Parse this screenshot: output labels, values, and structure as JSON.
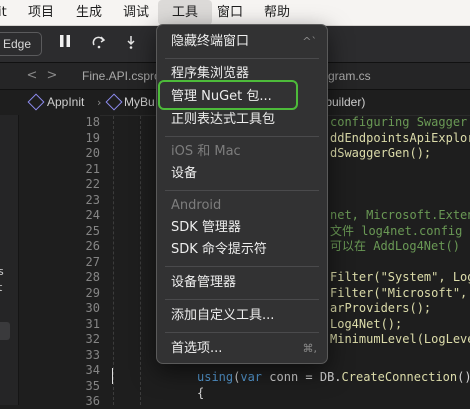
{
  "menubar": {
    "items": [
      {
        "label": "it"
      },
      {
        "label": "项目"
      },
      {
        "label": "生成"
      },
      {
        "label": "调试"
      },
      {
        "label": "工具"
      },
      {
        "label": "窗口"
      },
      {
        "label": "帮助"
      }
    ]
  },
  "toolbar": {
    "edge_label": "Edge",
    "icons": [
      "pause-icon",
      "step-over-icon",
      "step-into-icon"
    ]
  },
  "tabs": {
    "back_label": "<",
    "forward_label": ">",
    "items": [
      {
        "label": "Fine.API.cspro"
      },
      {
        "label": "gram.cs"
      }
    ]
  },
  "breadcrumb": {
    "items": [
      {
        "label": "AppInit"
      },
      {
        "label": "MyBu"
      },
      {
        "label": "r builder)"
      }
    ],
    "separator": "›"
  },
  "left_glyphs": [
    "s",
    "t"
  ],
  "editor": {
    "line_numbers": [
      "18",
      "19",
      "20",
      "21",
      "22",
      "23",
      "24",
      "25",
      "26",
      "27",
      "28",
      "29",
      "30",
      "31",
      "32",
      "33",
      "34",
      "35",
      "36"
    ],
    "code_right": [
      {
        "line": 0,
        "text": "configuring Swagger",
        "color": "#6a9955"
      },
      {
        "line": 1,
        "text": "ddEndpointsApiExplore",
        "color": "#dcdcaa"
      },
      {
        "line": 2,
        "text": "dSwaggerGen();",
        "color": "#dcdcaa"
      },
      {
        "line": 6,
        "text": "net, Microsoft.Extens",
        "color": "#6a9955"
      },
      {
        "line": 7,
        "text": "文件 log4net.config 这",
        "color": "#6a9955"
      },
      {
        "line": 8,
        "text": "可以在 AddLog4Net()",
        "color": "#6a9955"
      },
      {
        "line": 10,
        "text": "Filter(\"System\", Log",
        "color": "#dcdcaa"
      },
      {
        "line": 11,
        "text": "Filter(\"Microsoft\",",
        "color": "#dcdcaa"
      },
      {
        "line": 12,
        "text": "arProviders();",
        "color": "#dcdcaa"
      },
      {
        "line": 13,
        "text": "Log4Net();",
        "color": "#dcdcaa"
      },
      {
        "line": 14,
        "text": "MinimumLevel(LogLeve",
        "color": "#dcdcaa"
      }
    ],
    "line35": {
      "kw": "using",
      "rest1": "(",
      "kw2": "var",
      "rest2": " conn = DB.",
      "fn": "CreateConnection",
      "rest3": "())"
    },
    "line36": "{"
  },
  "dropdown": {
    "items": [
      {
        "label": "隐藏终端窗口",
        "shortcut": "^`"
      },
      {
        "label": "程序集浏览器"
      },
      {
        "label": "管理 NuGet 包..."
      },
      {
        "label": "正则表达式工具包"
      },
      {
        "label": "iOS 和 Mac",
        "disabled": true
      },
      {
        "label": "设备"
      },
      {
        "label": "Android",
        "disabled": true
      },
      {
        "label": "SDK 管理器"
      },
      {
        "label": "SDK 命令提示符"
      },
      {
        "label": "设备管理器"
      },
      {
        "label": "添加自定义工具..."
      },
      {
        "label": "首选项...",
        "shortcut": "⌘,"
      }
    ],
    "highlight_color": "#4dbb3a"
  }
}
